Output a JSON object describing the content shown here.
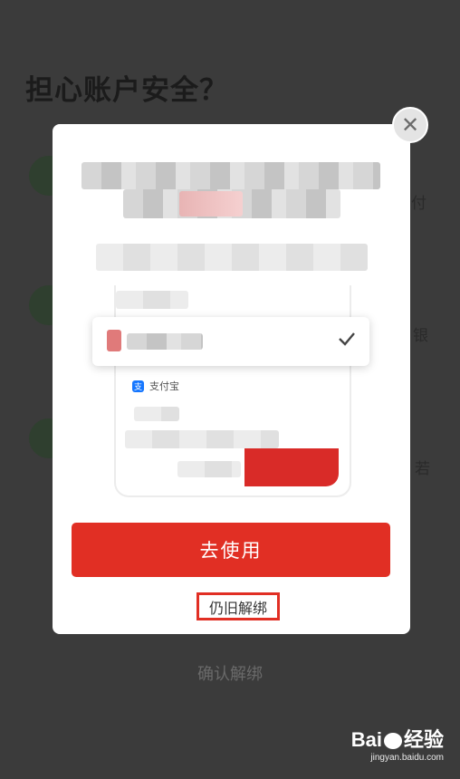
{
  "background": {
    "title": "担心账户安全？",
    "side_labels": [
      "付",
      "银",
      "若"
    ],
    "confirm_unbind": "确认解绑"
  },
  "modal": {
    "close_symbol": "✕",
    "illustration": {
      "alipay_label": "支付宝",
      "check_symbol": "✓"
    },
    "primary_button": "去使用",
    "secondary_link": "仍旧解绑"
  },
  "watermark": {
    "brand": "Bai",
    "brand_suffix": "经验",
    "url": "jingyan.baidu.com"
  },
  "colors": {
    "primary": "#e12f24",
    "overlay": "#3b3b3b",
    "alipay": "#1677ff"
  }
}
